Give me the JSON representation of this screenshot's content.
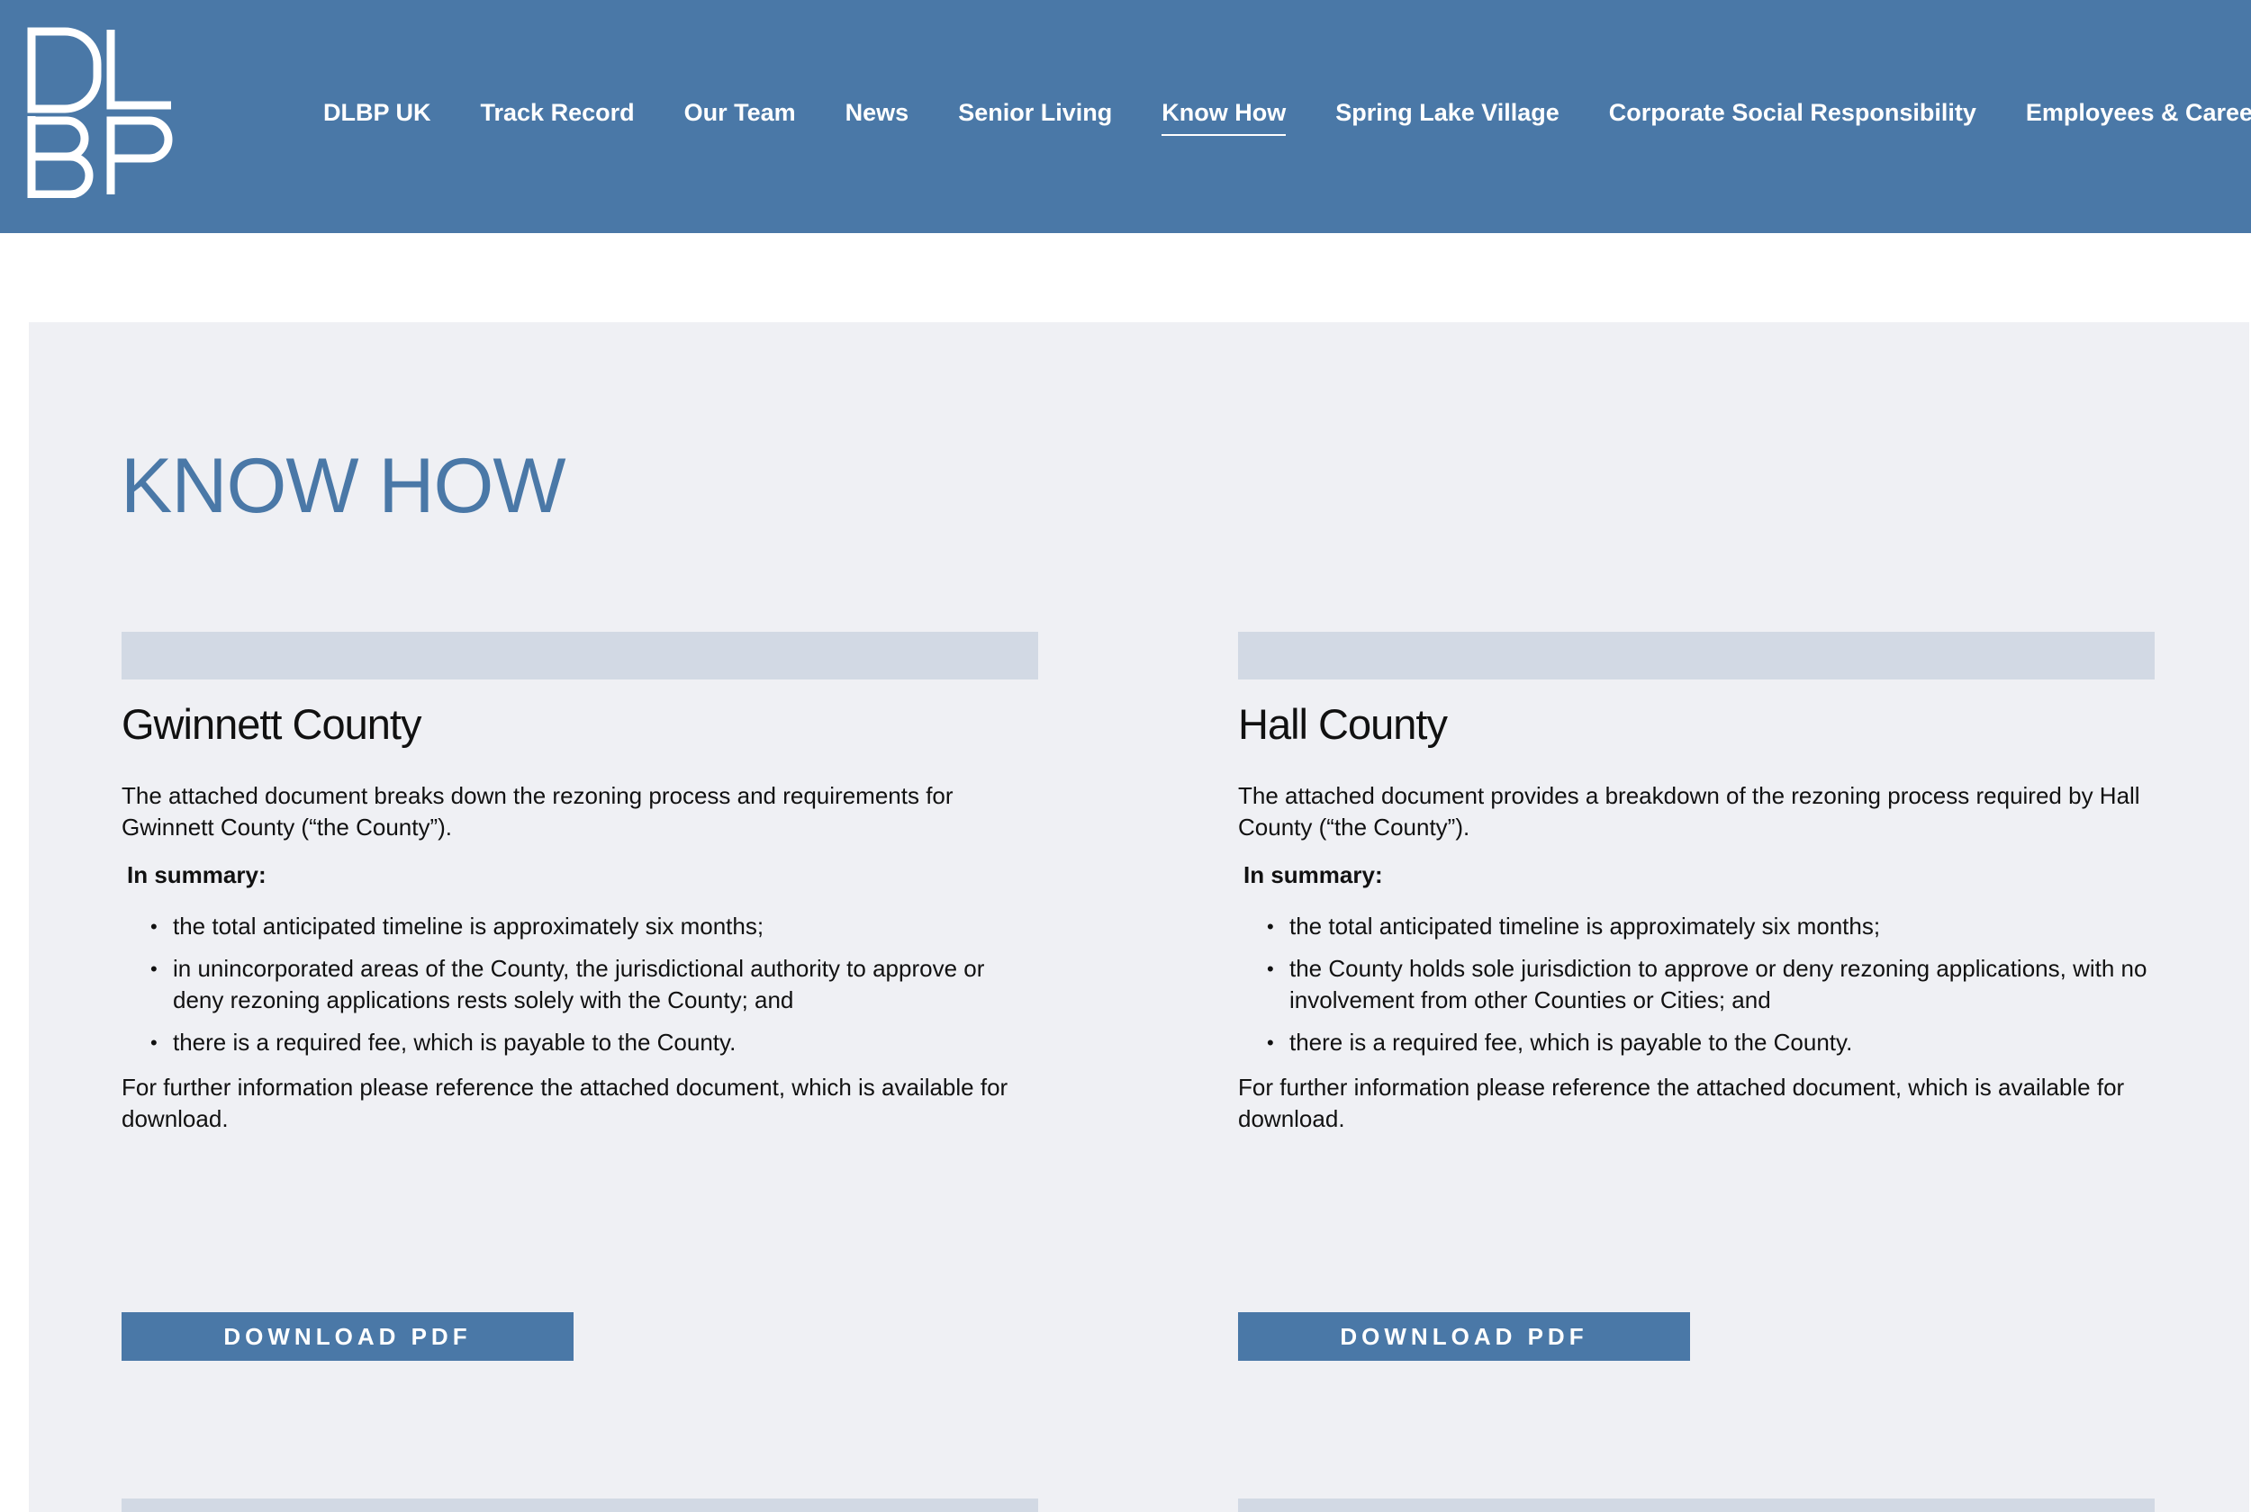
{
  "header": {
    "logo_text": "DLBP",
    "nav": [
      {
        "label": "DLBP UK",
        "active": false
      },
      {
        "label": "Track Record",
        "active": false
      },
      {
        "label": "Our Team",
        "active": false
      },
      {
        "label": "News",
        "active": false
      },
      {
        "label": "Senior Living",
        "active": false
      },
      {
        "label": "Know How",
        "active": true
      },
      {
        "label": "Spring Lake Village",
        "active": false
      },
      {
        "label": "Corporate Social Responsibility",
        "active": false
      },
      {
        "label": "Employees & Careers",
        "active": false
      }
    ]
  },
  "main": {
    "title": "KNOW HOW",
    "cards": [
      {
        "title": "Gwinnett County",
        "intro": "The attached document breaks down the rezoning process and requirements for Gwinnett County (“the County”).",
        "summary_label": "In summary:",
        "items": [
          "the total anticipated timeline is approximately six months;",
          "in unincorporated areas of the County, the jurisdictional authority to approve or deny rezoning applications rests solely with the County; and",
          "there is a required fee, which is payable to the County."
        ],
        "further": "For further information please reference the attached document, which is available for download.",
        "button": "DOWNLOAD PDF"
      },
      {
        "title": "Hall County",
        "intro": "The attached document provides a breakdown of the rezoning process required by Hall County (“the County”).",
        "summary_label": "In summary:",
        "items": [
          "the total anticipated timeline is approximately six months;",
          "the County holds sole jurisdiction to approve or deny rezoning applications, with no involvement from other Counties or Cities; and",
          "there is a required fee, which is payable to the County."
        ],
        "further": "For further information please reference the attached document, which is available for download.",
        "button": "DOWNLOAD PDF"
      }
    ]
  },
  "colors": {
    "brand_blue": "#4a78a7",
    "panel_bg": "#eff0f4",
    "card_bar": "#d2d9e4"
  }
}
